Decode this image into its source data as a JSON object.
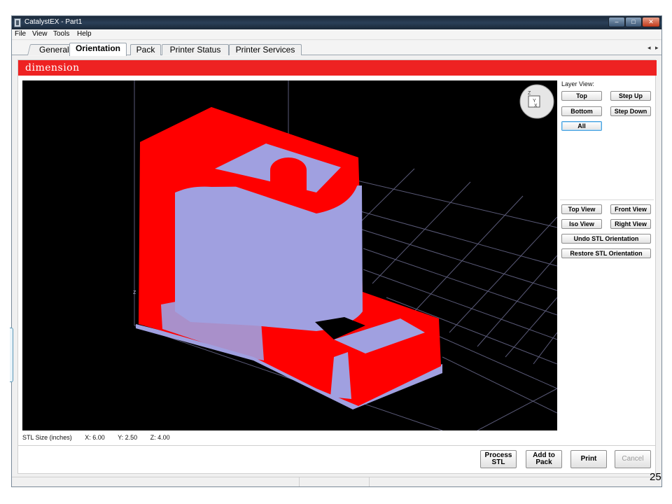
{
  "window": {
    "title": "CatalystEX - Part1",
    "controls": {
      "minimize": "–",
      "maximize": "□",
      "close": "✕"
    }
  },
  "menu": {
    "items": [
      "File",
      "View",
      "Tools",
      "Help"
    ]
  },
  "tabs": [
    "General",
    "Orientation",
    "Pack",
    "Printer Status",
    "Printer Services"
  ],
  "active_tab": "Orientation",
  "tab_scroll": "◂ ▸",
  "brand": {
    "logo": "dimension",
    "bar_color": "#ee2222"
  },
  "viewport": {
    "axis_label": "z",
    "cube_labels": {
      "z": "Z",
      "y": "Y",
      "x": "X"
    },
    "model_colors": {
      "outer": "#ff0000",
      "inner": "#a0a0e0"
    },
    "background": "#000000"
  },
  "layer_view": {
    "label": "Layer View:",
    "buttons": {
      "top": "Top",
      "step_up": "Step Up",
      "bottom": "Bottom",
      "step_down": "Step Down",
      "all": "All"
    }
  },
  "view_buttons": {
    "top_view": "Top View",
    "front_view": "Front View",
    "iso_view": "Iso View",
    "right_view": "Right View",
    "undo_stl": "Undo STL Orientation",
    "restore_stl": "Restore STL Orientation"
  },
  "stl_size": {
    "label": "STL Size (inches)",
    "x": "X: 6.00",
    "y": "Y: 2.50",
    "z": "Z: 4.00"
  },
  "bottom_buttons": {
    "process_stl": "Process\nSTL",
    "add_to_pack": "Add to\nPack",
    "print": "Print",
    "cancel": "Cancel"
  },
  "page_number": "25"
}
